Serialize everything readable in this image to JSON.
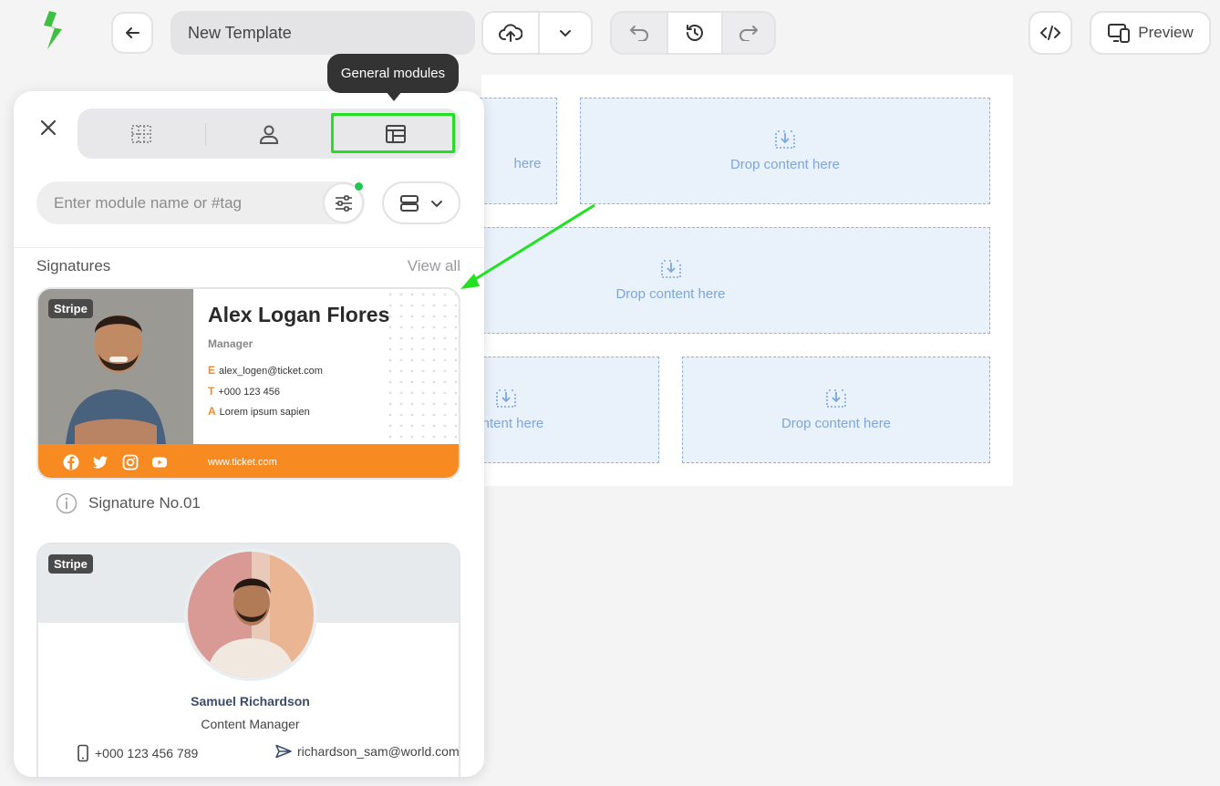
{
  "app": {
    "logo_icon": "stripo-logo-icon",
    "accent_color": "#3fbf3f"
  },
  "toolbar": {
    "title": "New Template",
    "preview_label": "Preview"
  },
  "canvas": {
    "drop_label": "Drop content here",
    "drop_label_partial_1": "here",
    "drop_label_partial_2": "content here"
  },
  "tooltip": "General modules",
  "panel": {
    "search_placeholder": "Enter module name or #tag",
    "section_title": "Signatures",
    "view_all": "View all",
    "highlight_color": "#22e022"
  },
  "signature1": {
    "badge": "Stripe",
    "name": "Alex Logan Flores",
    "role": "Manager",
    "email_key": "E",
    "email": "alex_logen@ticket.com",
    "phone_key": "T",
    "phone": "+000 123 456",
    "address_key": "A",
    "address": "Lorem ipsum sapien",
    "website": "www.ticket.com",
    "caption": "Signature No.01",
    "brand_color": "#f88a22"
  },
  "signature2": {
    "badge": "Stripe",
    "name": "Samuel Richardson",
    "role": "Content Manager",
    "phone": "+000 123 456 789",
    "email": "richardson_sam@world.com"
  }
}
